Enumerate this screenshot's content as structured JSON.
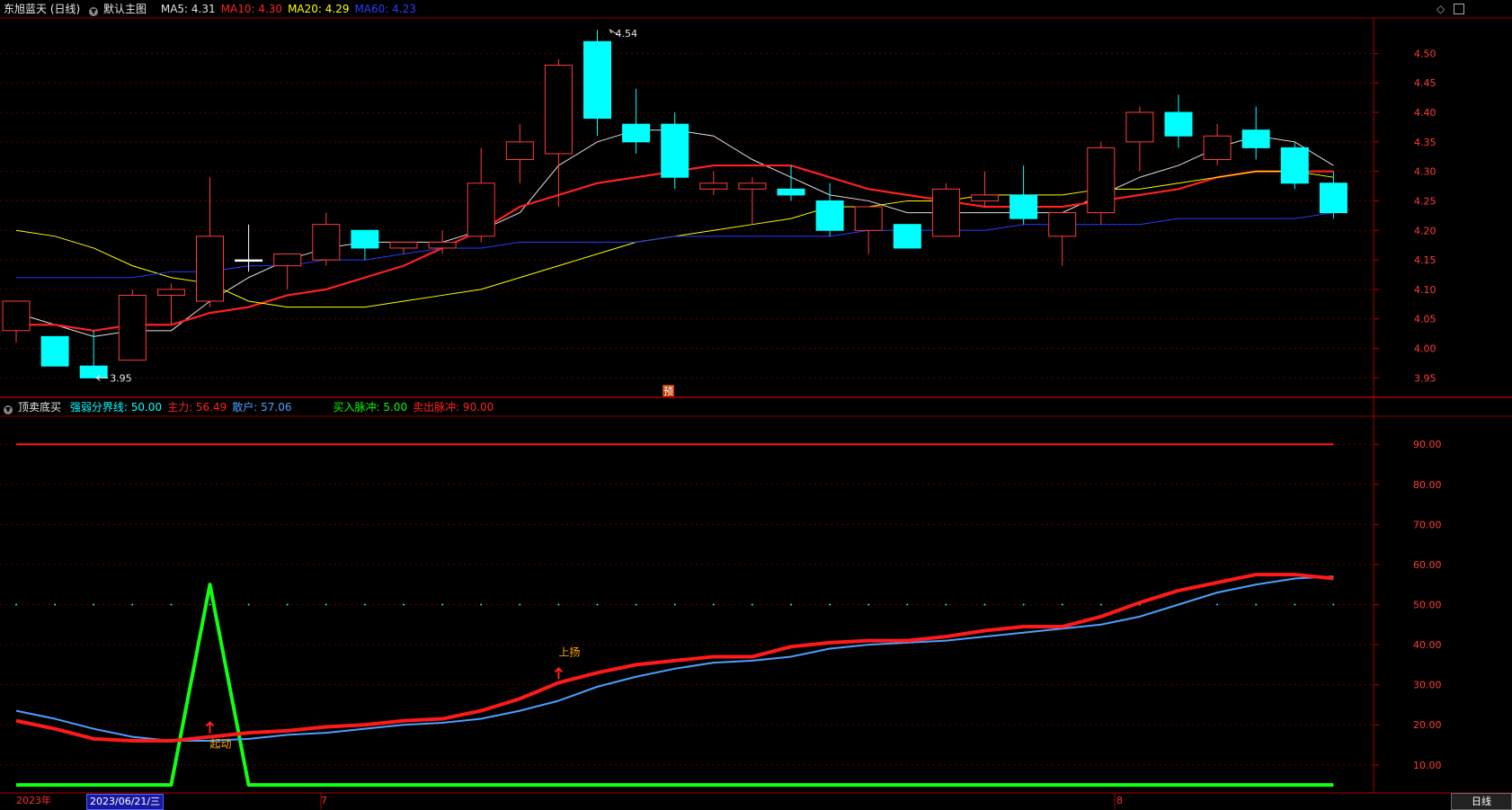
{
  "main": {
    "stock_name": "东旭蓝天 (日线)",
    "chart_menu": "默认主图",
    "ma": [
      {
        "label": "MA5",
        "value": "4.31",
        "color": "#e0e0e0"
      },
      {
        "label": "MA10",
        "value": "4.30",
        "color": "#ff2020"
      },
      {
        "label": "MA20",
        "value": "4.29",
        "color": "#ffff00"
      },
      {
        "label": "MA60",
        "value": "4.23",
        "color": "#2a3bff"
      }
    ],
    "high_label": "4.54",
    "low_label": "3.95",
    "forecast_marker": "预",
    "colors": {
      "up": "#ff3b3b",
      "down": "#00ffff",
      "cross": "#ffffff"
    }
  },
  "indicator": {
    "name": "顶卖底买",
    "items": [
      {
        "label": "强弱分界线",
        "value": "50.00",
        "color": "#00ffff"
      },
      {
        "label": "主力",
        "value": "56.49",
        "color": "#ff2020"
      },
      {
        "label": "散户",
        "value": "57.06",
        "color": "#4aa0ff"
      },
      {
        "label": "买入脉冲",
        "value": "5.00",
        "color": "#00ff00"
      },
      {
        "label": "卖出脉冲",
        "value": "90.00",
        "color": "#ff2020"
      }
    ],
    "annotations": [
      {
        "text": "起动",
        "color": "#ffa500"
      },
      {
        "text": "上扬",
        "color": "#ffa500"
      }
    ]
  },
  "timebar": {
    "year": "2023年",
    "cursor_date": "2023/06/21/三",
    "month_marks": [
      "7",
      "8"
    ],
    "period_button": "日线"
  },
  "chart_data": [
    {
      "type": "candlestick",
      "title": "东旭蓝天 (日线)",
      "ylim": [
        3.92,
        4.56
      ],
      "yticks": [
        "4.50",
        "4.45",
        "4.40",
        "4.35",
        "4.30",
        "4.25",
        "4.20",
        "4.15",
        "4.10",
        "4.05",
        "4.00",
        "3.95"
      ],
      "candles": [
        {
          "o": 4.03,
          "h": 4.08,
          "l": 4.01,
          "c": 4.08
        },
        {
          "o": 4.02,
          "h": 4.02,
          "l": 3.97,
          "c": 3.97
        },
        {
          "o": 3.97,
          "h": 4.03,
          "l": 3.95,
          "c": 3.95
        },
        {
          "o": 3.98,
          "h": 4.1,
          "l": 3.98,
          "c": 4.09
        },
        {
          "o": 4.09,
          "h": 4.11,
          "l": 4.04,
          "c": 4.1
        },
        {
          "o": 4.08,
          "h": 4.29,
          "l": 4.07,
          "c": 4.19
        },
        {
          "o": 4.15,
          "h": 4.21,
          "l": 4.13,
          "c": 4.15
        },
        {
          "o": 4.14,
          "h": 4.16,
          "l": 4.1,
          "c": 4.16
        },
        {
          "o": 4.15,
          "h": 4.23,
          "l": 4.14,
          "c": 4.21
        },
        {
          "o": 4.2,
          "h": 4.2,
          "l": 4.15,
          "c": 4.17
        },
        {
          "o": 4.17,
          "h": 4.18,
          "l": 4.16,
          "c": 4.18
        },
        {
          "o": 4.17,
          "h": 4.2,
          "l": 4.16,
          "c": 4.18
        },
        {
          "o": 4.19,
          "h": 4.34,
          "l": 4.18,
          "c": 4.28
        },
        {
          "o": 4.32,
          "h": 4.38,
          "l": 4.28,
          "c": 4.35
        },
        {
          "o": 4.33,
          "h": 4.49,
          "l": 4.24,
          "c": 4.48
        },
        {
          "o": 4.52,
          "h": 4.54,
          "l": 4.36,
          "c": 4.39
        },
        {
          "o": 4.38,
          "h": 4.44,
          "l": 4.33,
          "c": 4.35
        },
        {
          "o": 4.38,
          "h": 4.4,
          "l": 4.27,
          "c": 4.29
        },
        {
          "o": 4.27,
          "h": 4.3,
          "l": 4.26,
          "c": 4.28
        },
        {
          "o": 4.27,
          "h": 4.29,
          "l": 4.21,
          "c": 4.28
        },
        {
          "o": 4.27,
          "h": 4.31,
          "l": 4.25,
          "c": 4.26
        },
        {
          "o": 4.25,
          "h": 4.28,
          "l": 4.19,
          "c": 4.2
        },
        {
          "o": 4.2,
          "h": 4.24,
          "l": 4.16,
          "c": 4.24
        },
        {
          "o": 4.21,
          "h": 4.21,
          "l": 4.17,
          "c": 4.17
        },
        {
          "o": 4.19,
          "h": 4.28,
          "l": 4.19,
          "c": 4.27
        },
        {
          "o": 4.25,
          "h": 4.3,
          "l": 4.24,
          "c": 4.26
        },
        {
          "o": 4.26,
          "h": 4.31,
          "l": 4.21,
          "c": 4.22
        },
        {
          "o": 4.19,
          "h": 4.23,
          "l": 4.14,
          "c": 4.23
        },
        {
          "o": 4.23,
          "h": 4.35,
          "l": 4.21,
          "c": 4.34
        },
        {
          "o": 4.35,
          "h": 4.41,
          "l": 4.3,
          "c": 4.4
        },
        {
          "o": 4.4,
          "h": 4.43,
          "l": 4.34,
          "c": 4.36
        },
        {
          "o": 4.32,
          "h": 4.38,
          "l": 4.31,
          "c": 4.36
        },
        {
          "o": 4.37,
          "h": 4.41,
          "l": 4.32,
          "c": 4.34
        },
        {
          "o": 4.34,
          "h": 4.35,
          "l": 4.27,
          "c": 4.28
        },
        {
          "o": 4.28,
          "h": 4.3,
          "l": 4.22,
          "c": 4.23
        }
      ],
      "series": [
        {
          "name": "MA5",
          "values": [
            4.06,
            4.04,
            4.02,
            4.03,
            4.03,
            4.08,
            4.12,
            4.15,
            4.17,
            4.18,
            4.18,
            4.18,
            4.2,
            4.23,
            4.31,
            4.35,
            4.37,
            4.37,
            4.36,
            4.32,
            4.29,
            4.26,
            4.25,
            4.23,
            4.23,
            4.23,
            4.23,
            4.23,
            4.26,
            4.29,
            4.31,
            4.34,
            4.36,
            4.35,
            4.31
          ]
        },
        {
          "name": "MA10",
          "values": [
            4.04,
            4.04,
            4.03,
            4.04,
            4.04,
            4.06,
            4.07,
            4.09,
            4.1,
            4.12,
            4.14,
            4.17,
            4.2,
            4.24,
            4.26,
            4.28,
            4.29,
            4.3,
            4.31,
            4.31,
            4.31,
            4.29,
            4.27,
            4.26,
            4.25,
            4.24,
            4.24,
            4.24,
            4.25,
            4.26,
            4.27,
            4.29,
            4.3,
            4.3,
            4.3
          ]
        },
        {
          "name": "MA20",
          "values": [
            4.2,
            4.19,
            4.17,
            4.14,
            4.12,
            4.11,
            4.08,
            4.07,
            4.07,
            4.07,
            4.08,
            4.09,
            4.1,
            4.12,
            4.14,
            4.16,
            4.18,
            4.19,
            4.2,
            4.21,
            4.22,
            4.24,
            4.24,
            4.25,
            4.25,
            4.26,
            4.26,
            4.26,
            4.27,
            4.27,
            4.28,
            4.29,
            4.3,
            4.3,
            4.29
          ]
        },
        {
          "name": "MA60",
          "values": [
            4.12,
            4.12,
            4.12,
            4.12,
            4.13,
            4.13,
            4.14,
            4.14,
            4.15,
            4.15,
            4.16,
            4.17,
            4.17,
            4.18,
            4.18,
            4.18,
            4.18,
            4.19,
            4.19,
            4.19,
            4.19,
            4.19,
            4.2,
            4.2,
            4.2,
            4.2,
            4.21,
            4.21,
            4.21,
            4.21,
            4.22,
            4.22,
            4.22,
            4.22,
            4.23
          ]
        }
      ]
    },
    {
      "type": "line",
      "title": "顶卖底买",
      "ylim": [
        3,
        97
      ],
      "yticks": [
        "90.00",
        "80.00",
        "70.00",
        "60.00",
        "50.00",
        "40.00",
        "30.00",
        "20.00",
        "10.00"
      ],
      "series": [
        {
          "name": "主力",
          "values": [
            21,
            19,
            16.5,
            16,
            16,
            17,
            18,
            18.5,
            19.5,
            20,
            21,
            21.5,
            23.5,
            26.5,
            30.5,
            33,
            35,
            36,
            37,
            37,
            39.5,
            40.5,
            41,
            41,
            42,
            43.5,
            44.5,
            44.5,
            47,
            50.5,
            53.5,
            55.5,
            57.5,
            57.5,
            56.5
          ]
        },
        {
          "name": "散户",
          "values": [
            23.5,
            21.5,
            19,
            17,
            16,
            16,
            16.5,
            17.5,
            18,
            19,
            20,
            20.5,
            21.5,
            23.5,
            26,
            29.5,
            32,
            34,
            35.5,
            36,
            37,
            39,
            40,
            40.5,
            41,
            42,
            43,
            44,
            45,
            47,
            50,
            53,
            55,
            56.5,
            57
          ]
        },
        {
          "name": "买入脉冲",
          "values": [
            5,
            5,
            5,
            5,
            5,
            55,
            5,
            5,
            5,
            5,
            5,
            5,
            5,
            5,
            5,
            5,
            5,
            5,
            5,
            5,
            5,
            5,
            5,
            5,
            5,
            5,
            5,
            5,
            5,
            5,
            5,
            5,
            5,
            5,
            5
          ]
        },
        {
          "name": "卖出脉冲",
          "values": [
            90,
            90,
            90,
            90,
            90,
            90,
            90,
            90,
            90,
            90,
            90,
            90,
            90,
            90,
            90,
            90,
            90,
            90,
            90,
            90,
            90,
            90,
            90,
            90,
            90,
            90,
            90,
            90,
            90,
            90,
            90,
            90,
            90,
            90,
            90
          ]
        },
        {
          "name": "强弱分界线",
          "values": [
            50,
            50,
            50,
            50,
            50,
            50,
            50,
            50,
            50,
            50,
            50,
            50,
            50,
            50,
            50,
            50,
            50,
            50,
            50,
            50,
            50,
            50,
            50,
            50,
            50,
            50,
            50,
            50,
            50,
            50,
            50,
            50,
            50,
            50,
            50
          ]
        }
      ]
    }
  ]
}
